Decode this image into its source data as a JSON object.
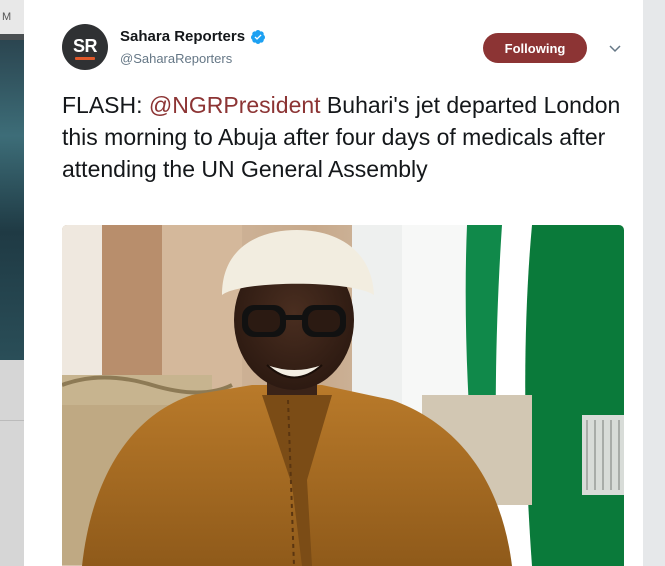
{
  "backdrop": {
    "top_text": "M"
  },
  "tweet": {
    "author": {
      "display_name": "Sahara Reporters",
      "handle": "@SaharaReporters",
      "avatar_monogram": "SR",
      "verified": true
    },
    "follow_button_label": "Following",
    "text_prefix": "FLASH: ",
    "mention": "@NGRPresident",
    "text_body": " Buhari's jet departed London this morning to Abuja after four days of medicals after attending the UN General Assembly",
    "media": {
      "description_icon": "photo-image"
    }
  },
  "colors": {
    "accent": "#8c3434",
    "verified_blue": "#1da1f2",
    "avatar_bg": "#2f3133",
    "avatar_bar": "#e0582a"
  }
}
